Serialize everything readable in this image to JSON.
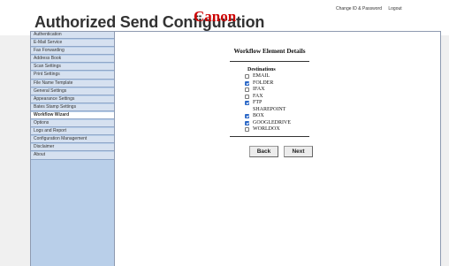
{
  "header": {
    "title": "Authorized Send Configuration",
    "brand": "Canon",
    "links": [
      "Change ID & Password",
      "Logout"
    ]
  },
  "sidebar": {
    "items": [
      "Authentication",
      "E-Mail Service",
      "Fax Forwarding",
      "Address Book",
      "Scan Settings",
      "Print Settings",
      "File Name Template",
      "General Settings",
      "Appearance Settings",
      "Bates Stamp Settings",
      "Workflow Wizard",
      "Options",
      "Logs and Report",
      "Configuration Management",
      "Disclaimer",
      "About"
    ],
    "active": "Workflow Wizard"
  },
  "panel": {
    "title": "Workflow Element Details",
    "destinations_heading": "Destinations",
    "options": [
      {
        "label": "EMAIL",
        "checked": false
      },
      {
        "label": "FOLDER",
        "checked": true
      },
      {
        "label": "IFAX",
        "checked": false
      },
      {
        "label": "FAX",
        "checked": false
      },
      {
        "label": "FTP",
        "checked": true
      },
      {
        "label": "SHAREPOINT",
        "checked": null
      },
      {
        "label": "BOX",
        "checked": true
      },
      {
        "label": "GOOGLEDRIVE",
        "checked": true
      },
      {
        "label": "WORLDOX",
        "checked": false
      }
    ],
    "back_label": "Back",
    "next_label": "Next"
  },
  "colors": {
    "sidebar_bg": "#b9cfe9",
    "sidebar_item_bg": "#d6e1f0",
    "brand_red": "#cc0000",
    "checkbox_blue": "#2a67c7"
  }
}
